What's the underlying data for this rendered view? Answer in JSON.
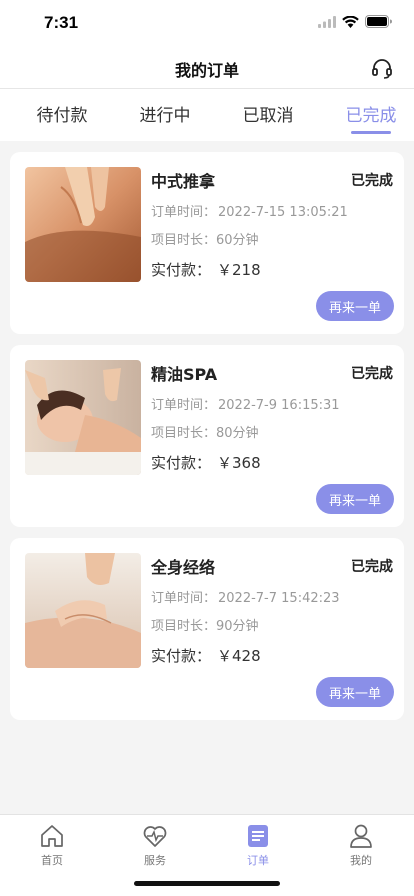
{
  "status_bar": {
    "time": "7:31"
  },
  "nav": {
    "title": "我的订单",
    "service_icon": "headset-icon"
  },
  "tabs": [
    {
      "label": "待付款",
      "active": false
    },
    {
      "label": "进行中",
      "active": false
    },
    {
      "label": "已取消",
      "active": false
    },
    {
      "label": "已完成",
      "active": true
    }
  ],
  "labels": {
    "order_time": "订单时间：",
    "duration": "项目时长：",
    "paid": "实付款：",
    "reorder": "再来一单"
  },
  "orders": [
    {
      "name": "中式推拿",
      "status": "已完成",
      "time": "2022-7-15 13:05:21",
      "duration": "60分钟",
      "amount": "￥218"
    },
    {
      "name": "精油SPA",
      "status": "已完成",
      "time": "2022-7-9 16:15:31",
      "duration": "80分钟",
      "amount": "￥368"
    },
    {
      "name": "全身经络",
      "status": "已完成",
      "time": "2022-7-7 15:42:23",
      "duration": "90分钟",
      "amount": "￥428"
    }
  ],
  "bottom_nav": [
    {
      "label": "首页",
      "icon": "home-icon"
    },
    {
      "label": "服务",
      "icon": "heartbeat-icon"
    },
    {
      "label": "订单",
      "icon": "order-list-icon",
      "active": true
    },
    {
      "label": "我的",
      "icon": "user-icon"
    }
  ],
  "colors": {
    "accent": "#8a8fe8",
    "background": "#f4f4f4"
  }
}
